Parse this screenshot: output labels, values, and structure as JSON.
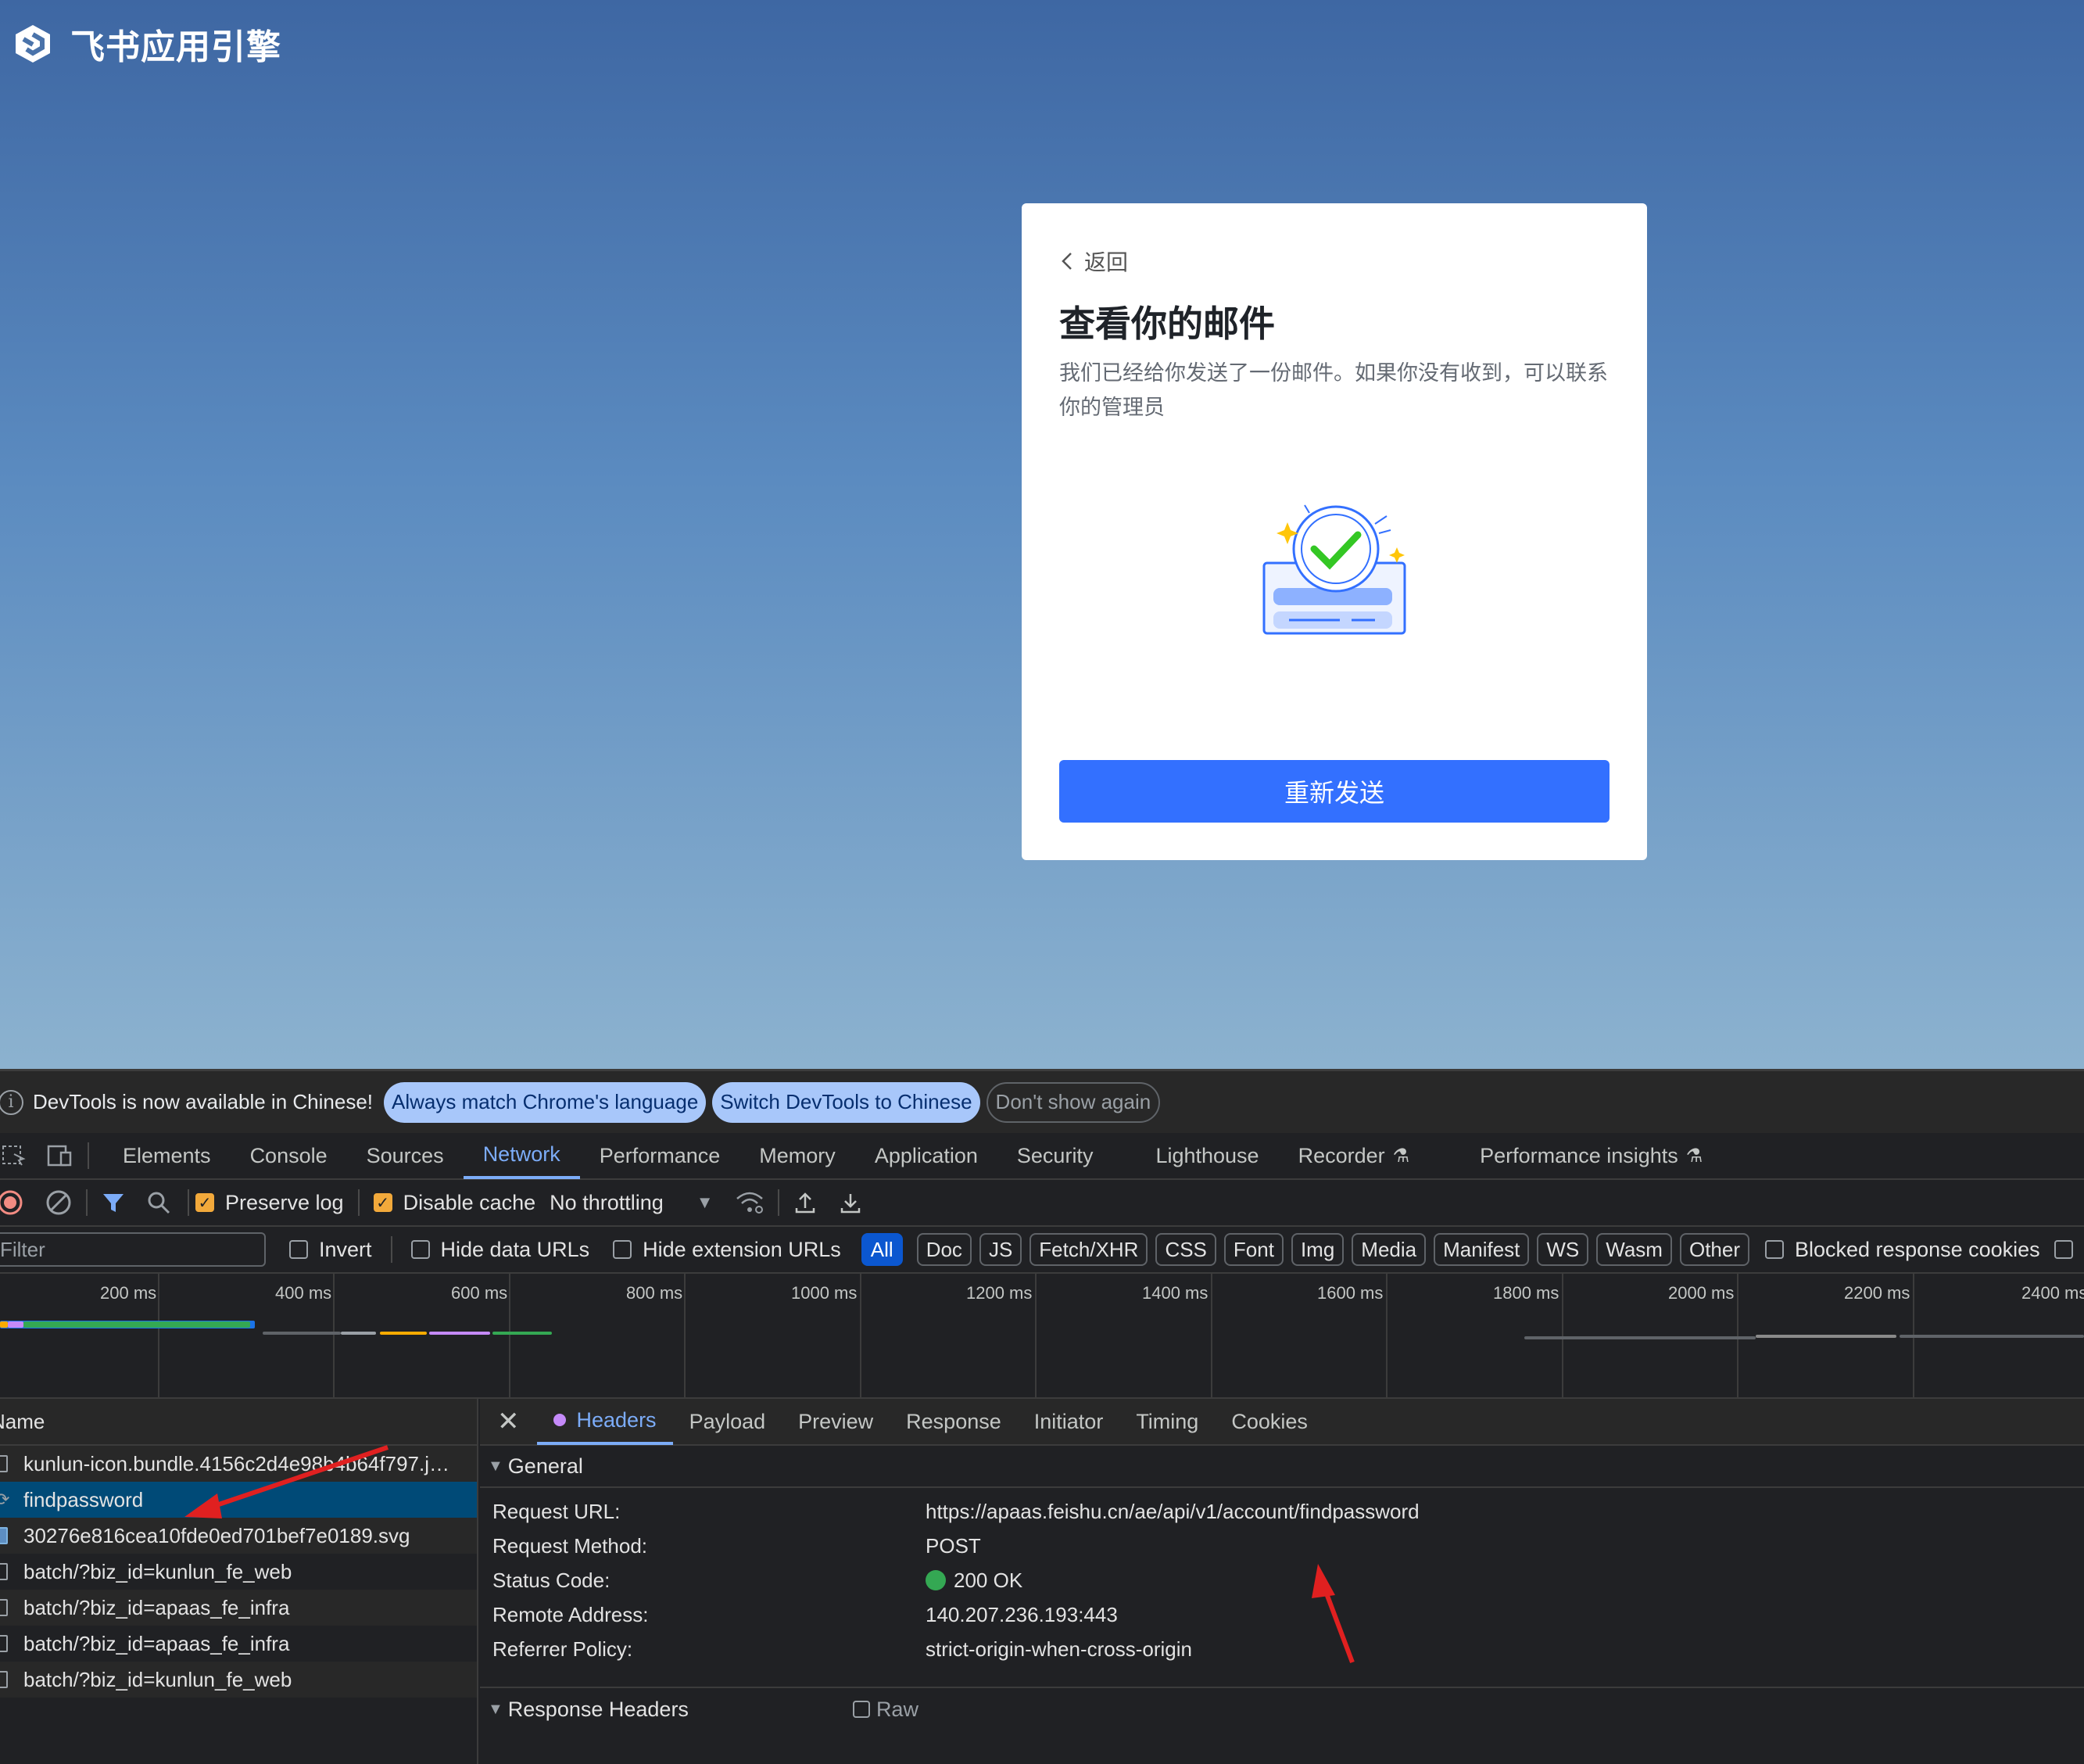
{
  "page": {
    "logo_text": "飞书应用引擎",
    "card": {
      "back_label": "返回",
      "title": "查看你的邮件",
      "description": "我们已经给你发送了一份邮件。如果你没有收到，可以联系你的管理员",
      "resend_button": "重新发送"
    }
  },
  "devtools": {
    "infobar": {
      "message": "DevTools is now available in Chinese!",
      "match_button": "Always match Chrome's language",
      "switch_button": "Switch DevTools to Chinese",
      "dismiss_button": "Don't show again"
    },
    "tabs": [
      "Elements",
      "Console",
      "Sources",
      "Network",
      "Performance",
      "Memory",
      "Application",
      "Security",
      "Lighthouse",
      "Recorder",
      "Performance insights"
    ],
    "active_tab": "Network",
    "toolbar": {
      "preserve_log": "Preserve log",
      "disable_cache": "Disable cache",
      "throttling": "No throttling"
    },
    "filterbar": {
      "placeholder": "Filter",
      "invert": "Invert",
      "hide_data_urls": "Hide data URLs",
      "hide_extension_urls": "Hide extension URLs",
      "types": [
        "All",
        "Doc",
        "JS",
        "Fetch/XHR",
        "CSS",
        "Font",
        "Img",
        "Media",
        "Manifest",
        "WS",
        "Wasm",
        "Other"
      ],
      "blocked_cookies": "Blocked response cookies"
    },
    "timeline_ticks": [
      "200 ms",
      "400 ms",
      "600 ms",
      "800 ms",
      "1000 ms",
      "1200 ms",
      "1400 ms",
      "1600 ms",
      "1800 ms",
      "2000 ms",
      "2200 ms",
      "2400 ms"
    ],
    "requests": {
      "header": "Name",
      "items": [
        "kunlun-icon.bundle.4156c2d4e98b4b64f797.j…",
        "findpassword",
        "30276e816cea10fde0ed701bef7e0189.svg",
        "batch/?biz_id=kunlun_fe_web",
        "batch/?biz_id=apaas_fe_infra",
        "batch/?biz_id=apaas_fe_infra",
        "batch/?biz_id=kunlun_fe_web"
      ]
    },
    "details": {
      "tabs": [
        "Headers",
        "Payload",
        "Preview",
        "Response",
        "Initiator",
        "Timing",
        "Cookies"
      ],
      "general_title": "General",
      "general": [
        {
          "k": "Request URL:",
          "v": "https://apaas.feishu.cn/ae/api/v1/account/findpassword"
        },
        {
          "k": "Request Method:",
          "v": "POST"
        },
        {
          "k": "Status Code:",
          "v": "200 OK"
        },
        {
          "k": "Remote Address:",
          "v": "140.207.236.193:443"
        },
        {
          "k": "Referrer Policy:",
          "v": "strict-origin-when-cross-origin"
        }
      ],
      "response_headers_title": "Response Headers",
      "raw_label": "Raw"
    }
  }
}
